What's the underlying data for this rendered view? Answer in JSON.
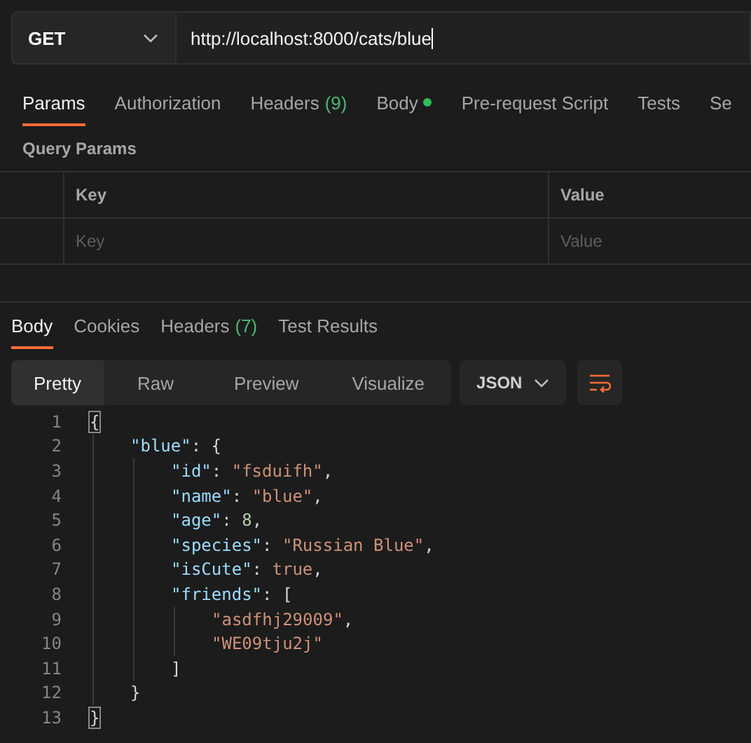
{
  "request": {
    "method": "GET",
    "url": "http://localhost:8000/cats/blue"
  },
  "request_tabs": [
    {
      "label": "Params",
      "dot": false,
      "selected": true
    },
    {
      "label": "Authorization",
      "dot": false,
      "selected": false
    },
    {
      "label": "Headers",
      "count": "(9)",
      "dot": false,
      "selected": false
    },
    {
      "label": "Body",
      "dot": true,
      "selected": false
    },
    {
      "label": "Pre-request Script",
      "dot": false,
      "selected": false
    },
    {
      "label": "Tests",
      "dot": false,
      "selected": false
    },
    {
      "label": "Se",
      "dot": false,
      "selected": false
    }
  ],
  "query_params": {
    "title": "Query Params",
    "columns": [
      "Key",
      "Value"
    ],
    "placeholders": [
      "Key",
      "Value"
    ]
  },
  "response_tabs": [
    {
      "label": "Body",
      "selected": true
    },
    {
      "label": "Cookies",
      "selected": false
    },
    {
      "label": "Headers",
      "count": "(7)",
      "selected": false
    },
    {
      "label": "Test Results",
      "selected": false
    }
  ],
  "view_modes": [
    {
      "label": "Pretty",
      "selected": true
    },
    {
      "label": "Raw",
      "selected": false
    },
    {
      "label": "Preview",
      "selected": false
    },
    {
      "label": "Visualize",
      "selected": false
    }
  ],
  "format": "JSON",
  "code": [
    {
      "number": "1",
      "tokens": [
        {
          "kind": "match",
          "text": "{"
        }
      ],
      "children": [
        {
          "number": "2",
          "tokens": [
            {
              "kind": "key",
              "text": "\"blue\""
            },
            {
              "kind": "punct",
              "text": ": {"
            }
          ],
          "children": [
            {
              "number": "3",
              "tokens": [
                {
                  "kind": "key",
                  "text": "\"id\""
                },
                {
                  "kind": "punct",
                  "text": ": "
                },
                {
                  "kind": "string",
                  "text": "\"fsduifh\""
                },
                {
                  "kind": "punct",
                  "text": ","
                }
              ]
            },
            {
              "number": "4",
              "tokens": [
                {
                  "kind": "key",
                  "text": "\"name\""
                },
                {
                  "kind": "punct",
                  "text": ": "
                },
                {
                  "kind": "string",
                  "text": "\"blue\""
                },
                {
                  "kind": "punct",
                  "text": ","
                }
              ]
            },
            {
              "number": "5",
              "tokens": [
                {
                  "kind": "key",
                  "text": "\"age\""
                },
                {
                  "kind": "punct",
                  "text": ": "
                },
                {
                  "kind": "number",
                  "text": "8"
                },
                {
                  "kind": "punct",
                  "text": ","
                }
              ]
            },
            {
              "number": "6",
              "tokens": [
                {
                  "kind": "key",
                  "text": "\"species\""
                },
                {
                  "kind": "punct",
                  "text": ": "
                },
                {
                  "kind": "string",
                  "text": "\"Russian Blue\""
                },
                {
                  "kind": "punct",
                  "text": ","
                }
              ]
            },
            {
              "number": "7",
              "tokens": [
                {
                  "kind": "key",
                  "text": "\"isCute\""
                },
                {
                  "kind": "punct",
                  "text": ": "
                },
                {
                  "kind": "string",
                  "text": "true"
                },
                {
                  "kind": "punct",
                  "text": ","
                }
              ]
            },
            {
              "number": "8",
              "tokens": [
                {
                  "kind": "key",
                  "text": "\"friends\""
                },
                {
                  "kind": "punct",
                  "text": ": ["
                }
              ],
              "children": [
                {
                  "number": "9",
                  "tokens": [
                    {
                      "kind": "string",
                      "text": "\"asdfhj29009\""
                    },
                    {
                      "kind": "punct",
                      "text": ","
                    }
                  ]
                },
                {
                  "number": "10",
                  "tokens": [
                    {
                      "kind": "string",
                      "text": "\"WE09tju2j\""
                    }
                  ]
                }
              ]
            },
            {
              "number": "11",
              "tokens": [
                {
                  "kind": "punct",
                  "text": "]"
                }
              ]
            }
          ]
        },
        {
          "number": "12",
          "tokens": [
            {
              "kind": "punct",
              "text": "}"
            }
          ]
        }
      ]
    },
    {
      "number": "13",
      "tokens": [
        {
          "kind": "match",
          "text": "}"
        }
      ]
    }
  ]
}
